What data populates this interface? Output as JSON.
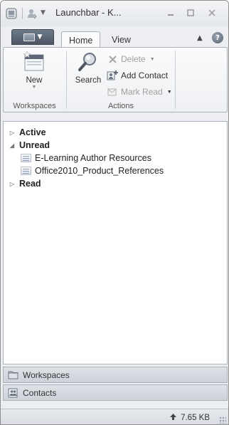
{
  "window": {
    "title": "Launchbar - K...",
    "minimize_icon": "minimize-icon",
    "maximize_icon": "maximize-icon",
    "close_icon": "close-icon"
  },
  "quick_access": {
    "app_icon": "app-icon",
    "user_icon": "user-icon",
    "customize_icon": "chevron-down-icon"
  },
  "ribbon": {
    "tabs": [
      "Home",
      "View"
    ],
    "active_tab": "Home",
    "groups": {
      "workspaces": {
        "label": "Workspaces",
        "new_label": "New"
      },
      "actions": {
        "label": "Actions",
        "search_label": "Search",
        "delete_label": "Delete",
        "add_contact_label": "Add Contact",
        "mark_read_label": "Mark Read"
      }
    }
  },
  "tree": {
    "active_label": "Active",
    "unread_label": "Unread",
    "unread_items": [
      "E-Learning Author Resources",
      "Office2010_Product_References"
    ],
    "read_label": "Read"
  },
  "nav": {
    "workspaces_label": "Workspaces",
    "contacts_label": "Contacts"
  },
  "status": {
    "size": "7.65 KB"
  }
}
